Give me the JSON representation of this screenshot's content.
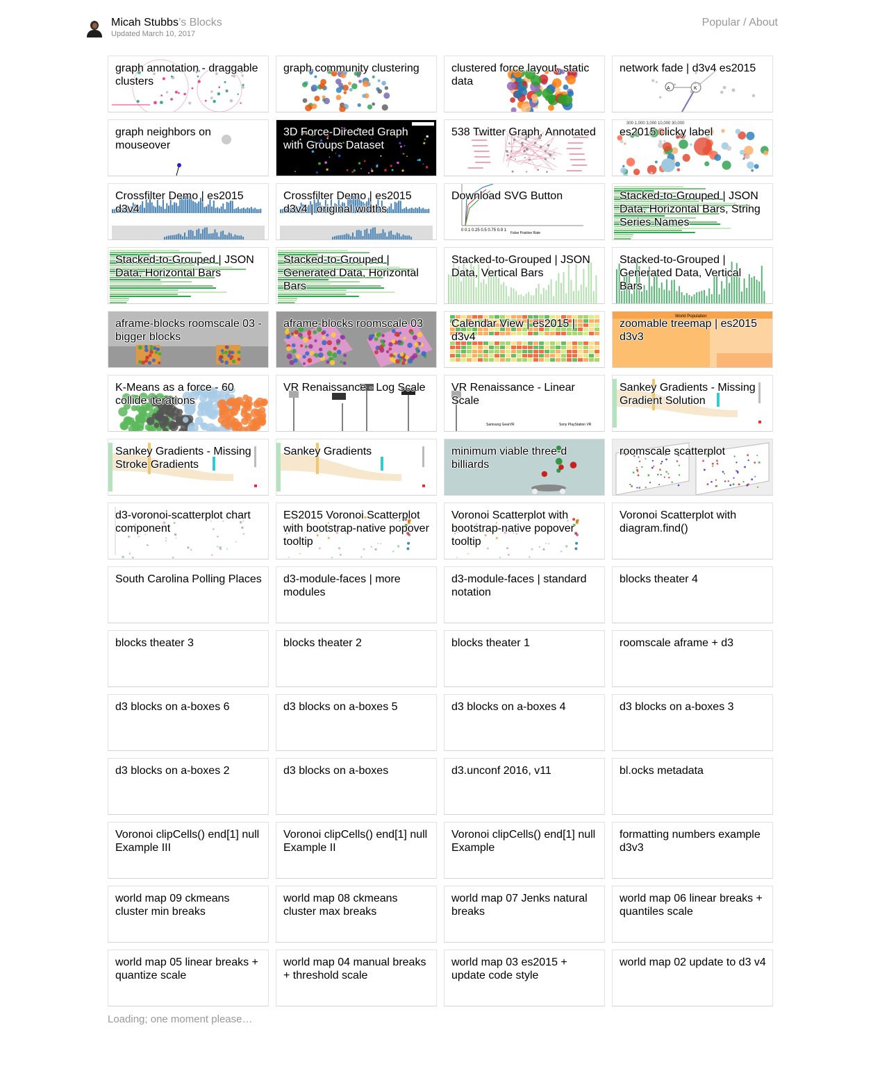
{
  "header": {
    "user_name": "Micah Stubbs",
    "user_suffix": "’s Blocks",
    "updated": "Updated March 10, 2017",
    "nav_popular": "Popular",
    "nav_separator": " / ",
    "nav_about": "About"
  },
  "blocks": [
    {
      "title": "graph annotation - draggable clusters",
      "thumb": "annotation"
    },
    {
      "title": "graph community clustering",
      "thumb": "community"
    },
    {
      "title": "clustered force layout, static data",
      "thumb": "clustered"
    },
    {
      "title": "network fade | d3v4 es2015",
      "thumb": "networkfade"
    },
    {
      "title": "graph neighbors on mouseover",
      "thumb": "neighbors"
    },
    {
      "title": "3D Force-Directed Graph with Groups Dataset",
      "thumb": "force3d",
      "dark": true
    },
    {
      "title": "538 Twitter Graph, Annotated",
      "thumb": "twitter538"
    },
    {
      "title": "es2015 clicky label",
      "thumb": "clicky"
    },
    {
      "title": "Crossfilter Demo | es2015 d3v4",
      "thumb": "crossfilter"
    },
    {
      "title": "Crossfilter Demo | es2015 d3v4 | original widths",
      "thumb": "crossfilter"
    },
    {
      "title": "Download SVG Button",
      "thumb": "roc"
    },
    {
      "title": "Stacked-to-Grouped | JSON Data, Horizontal Bars, String Series Names",
      "thumb": "hbars"
    },
    {
      "title": "Stacked-to-Grouped | JSON Data, Horizontal Bars",
      "thumb": "hbars"
    },
    {
      "title": "Stacked-to-Grouped | Generated Data, Horizontal Bars",
      "thumb": "hbars"
    },
    {
      "title": "Stacked-to-Grouped | JSON Data, Vertical Bars",
      "thumb": "vbars"
    },
    {
      "title": "Stacked-to-Grouped | Generated Data, Vertical Bars",
      "thumb": "vbars2"
    },
    {
      "title": "aframe-blocks roomscale 03 - bigger blocks",
      "thumb": "aframe"
    },
    {
      "title": "aframe-blocks roomscale 03",
      "thumb": "aframe2"
    },
    {
      "title": "Calendar View | es2015 | d3v4",
      "thumb": "calendar"
    },
    {
      "title": "zoomable treemap | es2015 d3v3",
      "thumb": "treemap"
    },
    {
      "title": "K-Means as a force - 60 collide iterations",
      "thumb": "kmeans"
    },
    {
      "title": "VR Renaissance - Log Scale",
      "thumb": "vrlog"
    },
    {
      "title": "VR Renaissance - Linear Scale",
      "thumb": "vrlin"
    },
    {
      "title": "Sankey Gradients - Missing Gradient Solution",
      "thumb": "sankey"
    },
    {
      "title": "Sankey Gradients - Missing Stroke Gradients",
      "thumb": "sankey"
    },
    {
      "title": "Sankey Gradients",
      "thumb": "sankey"
    },
    {
      "title": "minimum viable three-d billiards",
      "thumb": "billiards"
    },
    {
      "title": "roomscale scatterplot",
      "thumb": "roomscatter"
    },
    {
      "title": "d3-voronoi-scatterplot chart component",
      "thumb": "voronoi"
    },
    {
      "title": "ES2015 Voronoi Scatterplot with bootstrap-native popover tooltip",
      "thumb": "voronoi2"
    },
    {
      "title": "Voronoi Scatterplot with bootstrap-native popover tooltip",
      "thumb": "voronoi2"
    },
    {
      "title": "Voronoi Scatterplot with diagram.find()",
      "thumb": ""
    },
    {
      "title": "South Carolina Polling Places",
      "thumb": ""
    },
    {
      "title": "d3-module-faces | more modules",
      "thumb": ""
    },
    {
      "title": "d3-module-faces | standard notation",
      "thumb": ""
    },
    {
      "title": "blocks theater 4",
      "thumb": ""
    },
    {
      "title": "blocks theater 3",
      "thumb": ""
    },
    {
      "title": "blocks theater 2",
      "thumb": ""
    },
    {
      "title": "blocks theater 1",
      "thumb": ""
    },
    {
      "title": "roomscale aframe + d3",
      "thumb": ""
    },
    {
      "title": "d3 blocks on a-boxes 6",
      "thumb": ""
    },
    {
      "title": "d3 blocks on a-boxes 5",
      "thumb": ""
    },
    {
      "title": "d3 blocks on a-boxes 4",
      "thumb": ""
    },
    {
      "title": "d3 blocks on a-boxes 3",
      "thumb": ""
    },
    {
      "title": "d3 blocks on a-boxes 2",
      "thumb": ""
    },
    {
      "title": "d3 blocks on a-boxes",
      "thumb": ""
    },
    {
      "title": "d3.unconf 2016, v11",
      "thumb": ""
    },
    {
      "title": "bl.ocks metadata",
      "thumb": ""
    },
    {
      "title": "Voronoi clipCells() end[1] null Example III",
      "thumb": ""
    },
    {
      "title": "Voronoi clipCells() end[1] null Example II",
      "thumb": ""
    },
    {
      "title": "Voronoi clipCells() end[1] null Example",
      "thumb": ""
    },
    {
      "title": "formatting numbers example d3v3",
      "thumb": ""
    },
    {
      "title": "world map 09 ckmeans cluster min breaks",
      "thumb": ""
    },
    {
      "title": "world map 08 ckmeans cluster max breaks",
      "thumb": ""
    },
    {
      "title": "world map 07 Jenks natural breaks",
      "thumb": ""
    },
    {
      "title": "world map 06 linear breaks + quantiles scale",
      "thumb": ""
    },
    {
      "title": "world map 05 linear breaks + quantize scale",
      "thumb": ""
    },
    {
      "title": "world map 04 manual breaks + threshold scale",
      "thumb": ""
    },
    {
      "title": "world map 03 es2015 + update code style",
      "thumb": ""
    },
    {
      "title": "world map 02 update to d3 v4",
      "thumb": ""
    }
  ],
  "loading_text": "Loading; one moment please…"
}
